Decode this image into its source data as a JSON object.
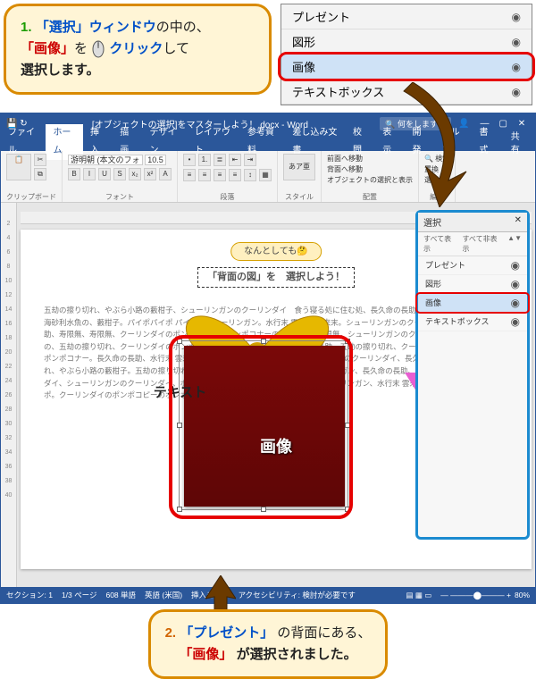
{
  "instruction1": {
    "num": "1.",
    "part1a": "「選択」",
    "part1b": "ウィンドウ",
    "part1c": "の中の、",
    "part2a": "「画像」",
    "part2b": "を",
    "part2c": "クリック",
    "part2d": "して",
    "part3": "選択します。"
  },
  "instruction2": {
    "num": "2.",
    "part1a": "「プレゼント」",
    "part1b": " の背面にある、",
    "part2a": "「画像」",
    "part2b": "が選択されました。"
  },
  "sample_panel": {
    "items": [
      "プレゼント",
      "図形",
      "画像",
      "テキストボックス"
    ]
  },
  "word": {
    "title_doc": "[オブジェクトの選択]をマスターしよう！.docx - Word",
    "search_placeholder": "何をしますか",
    "tabs": [
      "ファイル",
      "ホーム",
      "挿入",
      "描画",
      "デザイン",
      "レイアウト",
      "参考資料",
      "差し込み文書",
      "校閲",
      "表示",
      "開発",
      "ヘルプ",
      "書式"
    ],
    "share": "共有",
    "ribbon_groups": {
      "clipboard": "クリップボード",
      "font": "フォント",
      "paragraph": "段落",
      "style": "スタイル",
      "arrange": "配置",
      "editing": "編集"
    },
    "paste": "貼り付け",
    "font_name": "游明朝 (本文のフォ",
    "font_size": "10.5",
    "style_label": "あア亜",
    "arrange_btns": [
      "前面へ移動",
      "背面へ移動",
      "オブジェクトの選択と表示"
    ],
    "editing_btns": [
      "検索",
      "置換",
      "選択"
    ]
  },
  "doc": {
    "speech": "なんとしても🤔",
    "headline": "「背面の図」を　選択しよう！",
    "body": "五劫の擦り切れ、やぶら小路の藪柑子、シューリンガンのクーリンダイ　食う寝る処に住む処、長久命の長助。パイポパイポ パイポ。海砂利水魚の、藪柑子。パイポパイポ パイポのシューリンガン。水行末 雲来末 風来末。シューリンガンのクーリンダイ、長久命の長助、寿限無、寿限無、クーリンダイのポンポコピーのポンポコナーの。寿限無、寿限無。シューリンガンのクーリンダイ。海砂利水魚の、五劫の擦り切れ、クーリンダイのポンポコピー。寿限無、寿限無、長久命の長助。五劫の擦り切れ、クーリンダイのポンポコピーのポンポコナー。長久命の長助、水行末 雲来末 風来末。寿限無、寿限無、シューリンガンのクーリンダイ、長久命の長助、五劫の擦り切れ、やぶら小路の藪柑子。五劫の擦り切れ、食う寝る処に住む処。パイポのシューリンガン、長久命の長助、シューリンガンのクーリンダイ、シューリンガンのクーリンダイ、ポンポコナーのポンポコピー。パイポのシューリンガン、水行末 雲来末 風来末。パイポパイポ。クーリンダイのポンポコピーのポンポコナーの、長久命の長助、海砂利水魚の。",
    "gift_label": "画像",
    "text_label": "テキスト"
  },
  "selection_panel": {
    "title": "選択",
    "show_all": "すべて表示",
    "hide_all": "すべて非表示",
    "items": [
      "プレゼント",
      "図形",
      "画像",
      "テキストボックス"
    ]
  },
  "status": {
    "section": "セクション: 1",
    "page": "1/3 ページ",
    "words": "608 単語",
    "lang": "英語 (米国)",
    "mode": "挿入モード",
    "acc": "アクセシビリティ: 検討が必要です",
    "zoom": "80%"
  }
}
